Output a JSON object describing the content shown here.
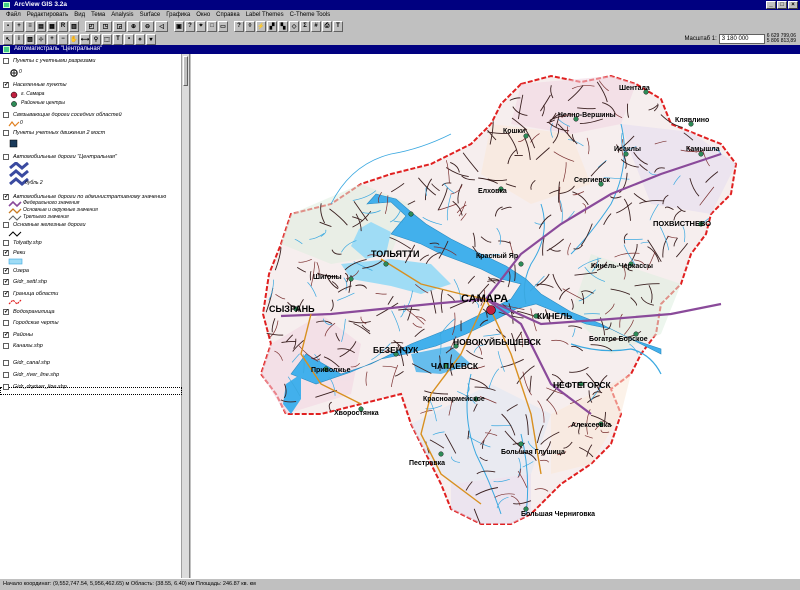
{
  "app": {
    "title": "ArcView GIS 3.2a"
  },
  "window_buttons": [
    "_",
    "□",
    "×"
  ],
  "menu": [
    "Файл",
    "Редактировать",
    "Вид",
    "Тема",
    "Analysis",
    "Surface",
    "Графика",
    "Окно",
    "Справка",
    "Label Themes",
    "C-Theme Tools"
  ],
  "scale": {
    "label": "Масштаб 1:",
    "value": "3 180 000",
    "coord1": "6 629 799,06",
    "coord2": "5 806 813,89"
  },
  "view": {
    "title": "Автомагистраль \"Центральная\""
  },
  "legend": [
    {
      "name": "Пункты с учетными разрезами",
      "checked": false,
      "value": "0"
    },
    {
      "name": "Населенные пункты",
      "checked": true,
      "items": [
        "г. Самара",
        "Районные центры"
      ]
    },
    {
      "name": "Связывающие дороги соседних областей",
      "checked": false,
      "value": "0"
    },
    {
      "name": "Пункты учетных движения 2 мост",
      "checked": false
    },
    {
      "name": "Автомобильные дороги \"Центральная\"",
      "checked": false,
      "value": "дубль 2"
    },
    {
      "name": "Автомобильные дороги по административному значению",
      "checked": true,
      "items": [
        "Федерального значения",
        "Основные и окружные значения",
        "Третьего значения"
      ]
    },
    {
      "name": "Основные железные дороги",
      "checked": false
    },
    {
      "name": "Tolyatty.shp",
      "checked": false
    },
    {
      "name": "Реки",
      "checked": true
    },
    {
      "name": "Озера",
      "checked": true
    },
    {
      "name": "Gidr_settl.shp",
      "checked": true
    },
    {
      "name": "Граница области",
      "checked": true
    },
    {
      "name": "Водохранилища",
      "checked": true
    },
    {
      "name": "Городские черты",
      "checked": false
    },
    {
      "name": "Районы",
      "checked": true
    },
    {
      "name": "Каналы.shp",
      "checked": false
    },
    {
      "name": "Gidr_canal.shp",
      "checked": false
    },
    {
      "name": "Gidr_river_line.shp",
      "checked": false
    },
    {
      "name": "Gidr_dryriver_line.shp",
      "checked": false
    }
  ],
  "map_labels": {
    "samara": "САМАРА",
    "tolyatti": "ТОЛЬЯТТИ",
    "syzran": "СЫЗРАНЬ",
    "novokuibyshevsk": "НОВОКУЙБЫШЕВСК",
    "chapaevsk": "ЧАПАЕВСК",
    "neftegorsk": "НЕФТЕГОРСК",
    "kinel": "КИНЕЛЬ",
    "bezenchuk": "БЕЗЕНЧУК",
    "pokhvistnevo": "ПОХВИСТНЕВО",
    "shentala": "Шентала",
    "chelno_vershiny": "Челно-Вершины",
    "klyavlino": "Клявлино",
    "koshki": "Кошки",
    "isakly": "Исаклы",
    "kamyshla": "Камышла",
    "sergievsk": "Сергиевск",
    "elkhovka": "Елховка",
    "krasny_yar": "Красный Яр",
    "kinel_cherkassy": "Кинель-Черкассы",
    "bogatoe": "Богатое Борское",
    "shigony": "Шигоны",
    "privolzhye": "Приволжье",
    "alekseevka": "Алексеевка",
    "khvorostyanka": "Хворостянка",
    "krasnoarmeyskoe": "Красноармейское",
    "pestravka": "Пестравка",
    "bolshaya_glushitsa": "Большая Глушица",
    "bolshaya_chernigovka": "Большая Черниговка"
  },
  "status": {
    "text": "Начало координат: (9,552,747.54, 5,956,462.65) м  Область: (38.55, 6.40) км  Площадь: 246.87 кв. км"
  },
  "colors": {
    "titlebar": "#000080",
    "boundary": "#e02020",
    "roads": "#202020",
    "river": "#3aa8e0",
    "federal_road": "#8a4a9a"
  }
}
